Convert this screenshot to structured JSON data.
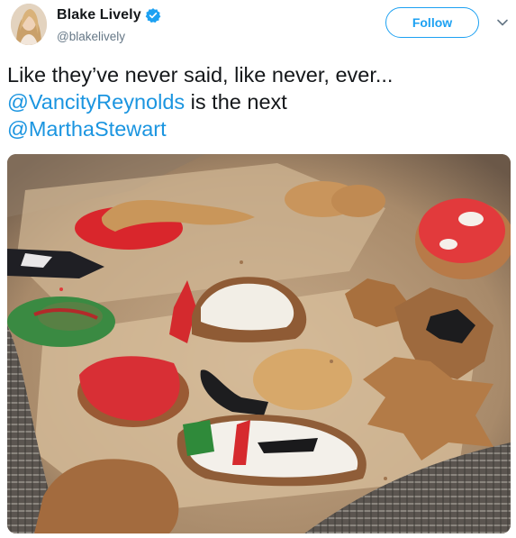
{
  "user": {
    "display_name": "Blake Lively",
    "handle": "@blakelively",
    "verified": true,
    "avatar_icon": "profile-photo"
  },
  "actions": {
    "follow_label": "Follow",
    "more_icon": "chevron-down-icon"
  },
  "tweet": {
    "line1": "Like they’ve never said, like never, ever...",
    "mention1": "@VancityReynolds",
    "middle": " is the next",
    "mention2": "@MarthaStewart"
  },
  "media": {
    "kind": "photo",
    "subject": "decorated-christmas-cookies"
  },
  "colors": {
    "accent": "#1da1f2",
    "mention": "#1b95e0",
    "text": "#14171a",
    "secondary": "#657786"
  }
}
